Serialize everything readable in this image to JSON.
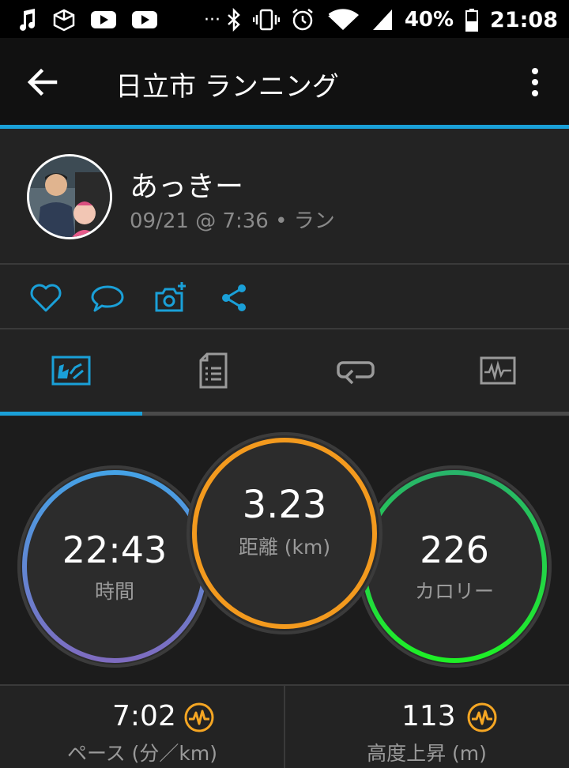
{
  "status_bar": {
    "time": "21:08",
    "battery": "40%",
    "overflow": "···"
  },
  "appbar": {
    "title": "日立市 ランニング"
  },
  "activity": {
    "user_name": "あっきー",
    "meta": "09/21 @ 7:36 • ラン"
  },
  "actions": [
    "heart-icon",
    "comment-icon",
    "add-photo-icon",
    "share-icon"
  ],
  "tabs": [
    "summary-tab",
    "details-tab",
    "laps-tab",
    "charts-tab"
  ],
  "stats": {
    "time": {
      "value": "22:43",
      "label": "時間"
    },
    "distance": {
      "value": "3.23",
      "label": "距離 (km)"
    },
    "calories": {
      "value": "226",
      "label": "カロリー"
    }
  },
  "bottom": {
    "pace": {
      "value": "7:02",
      "label": "ペース (分／km)"
    },
    "elevation": {
      "value": "113",
      "label": "高度上昇 (m)"
    }
  },
  "colors": {
    "accent": "#1aa0d8",
    "time_ring": "#4a90e2",
    "distance_ring": "#f39a1e",
    "calories_ring": "#25d04a",
    "badge": "#f5a623"
  }
}
